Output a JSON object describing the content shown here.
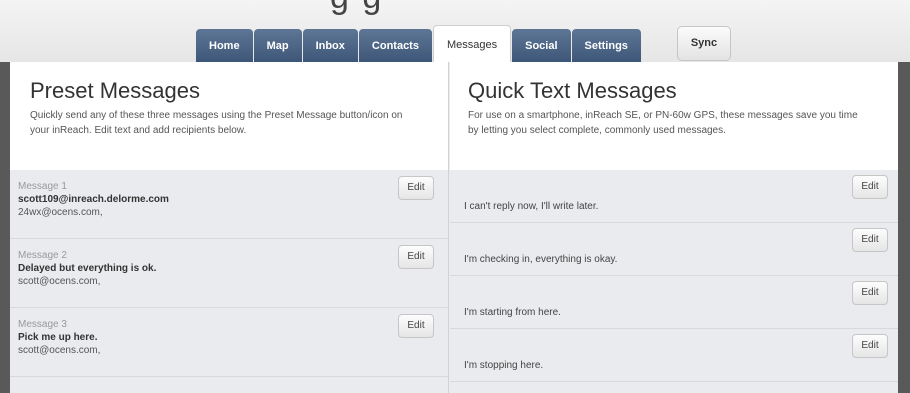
{
  "partial_heading": "g          g",
  "nav": {
    "tabs": [
      {
        "label": "Home"
      },
      {
        "label": "Map"
      },
      {
        "label": "Inbox"
      },
      {
        "label": "Contacts"
      },
      {
        "label": "Messages"
      },
      {
        "label": "Social"
      },
      {
        "label": "Settings"
      }
    ],
    "active_tab": "Messages",
    "sync_label": "Sync"
  },
  "preset": {
    "title": "Preset Messages",
    "description": "Quickly send any of these three messages using the Preset Message button/icon on your inReach. Edit text and add recipients below.",
    "messages": [
      {
        "label": "Message 1",
        "text": "scott109@inreach.delorme.com",
        "recipients": "24wx@ocens.com,",
        "edit_label": "Edit"
      },
      {
        "label": "Message 2",
        "text": "Delayed but everything is ok.",
        "recipients": "scott@ocens.com,",
        "edit_label": "Edit"
      },
      {
        "label": "Message 3",
        "text": "Pick me up here.",
        "recipients": "scott@ocens.com,",
        "edit_label": "Edit"
      }
    ]
  },
  "quick": {
    "title": "Quick Text Messages",
    "description": "For use on a smartphone, inReach SE, or PN-60w GPS, these messages save you time by letting you select complete, commonly used messages.",
    "messages": [
      {
        "text": "I can't reply now, I'll write later.",
        "edit_label": "Edit"
      },
      {
        "text": "I'm checking in, everything is okay.",
        "edit_label": "Edit"
      },
      {
        "text": "I'm starting from here.",
        "edit_label": "Edit"
      },
      {
        "text": "I'm stopping here.",
        "edit_label": "Edit"
      }
    ]
  },
  "colors": {
    "tab_bg": "#4a6384",
    "frame": "#595959",
    "panel_bg": "#e9ebee"
  }
}
